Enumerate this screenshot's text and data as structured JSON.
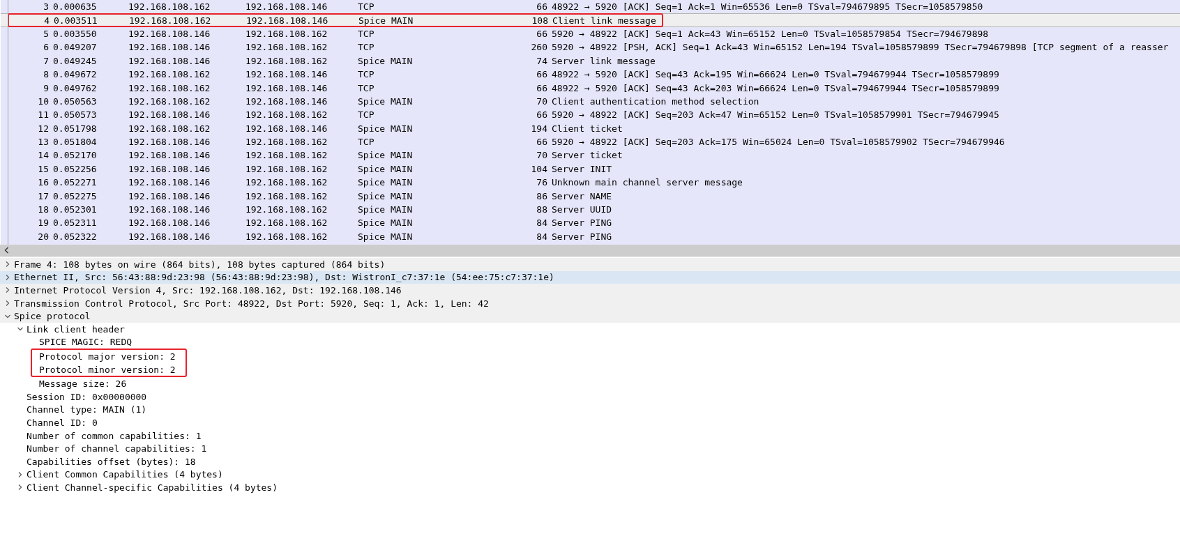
{
  "packet_list": {
    "rows": [
      {
        "no": "3",
        "time": "0.000635",
        "source": "192.168.108.162",
        "destination": "192.168.108.146",
        "protocol": "TCP",
        "length": "66",
        "info": "48922 → 5920 [ACK] Seq=1 Ack=1 Win=65536 Len=0 TSval=794679895 TSecr=1058579850",
        "selected": false,
        "annotated": false
      },
      {
        "no": "4",
        "time": "0.003511",
        "source": "192.168.108.162",
        "destination": "192.168.108.146",
        "protocol": "Spice MAIN",
        "length": "108",
        "info": "Client link message",
        "selected": true,
        "annotated": true
      },
      {
        "no": "5",
        "time": "0.003550",
        "source": "192.168.108.146",
        "destination": "192.168.108.162",
        "protocol": "TCP",
        "length": "66",
        "info": "5920 → 48922 [ACK] Seq=1 Ack=43 Win=65152 Len=0 TSval=1058579854 TSecr=794679898",
        "selected": false,
        "annotated": false
      },
      {
        "no": "6",
        "time": "0.049207",
        "source": "192.168.108.146",
        "destination": "192.168.108.162",
        "protocol": "TCP",
        "length": "260",
        "info": "5920 → 48922 [PSH, ACK] Seq=1 Ack=43 Win=65152 Len=194 TSval=1058579899 TSecr=794679898 [TCP segment of a reasser",
        "selected": false,
        "annotated": false
      },
      {
        "no": "7",
        "time": "0.049245",
        "source": "192.168.108.146",
        "destination": "192.168.108.162",
        "protocol": "Spice MAIN",
        "length": "74",
        "info": "Server link message",
        "selected": false,
        "annotated": false
      },
      {
        "no": "8",
        "time": "0.049672",
        "source": "192.168.108.162",
        "destination": "192.168.108.146",
        "protocol": "TCP",
        "length": "66",
        "info": "48922 → 5920 [ACK] Seq=43 Ack=195 Win=66624 Len=0 TSval=794679944 TSecr=1058579899",
        "selected": false,
        "annotated": false
      },
      {
        "no": "9",
        "time": "0.049762",
        "source": "192.168.108.162",
        "destination": "192.168.108.146",
        "protocol": "TCP",
        "length": "66",
        "info": "48922 → 5920 [ACK] Seq=43 Ack=203 Win=66624 Len=0 TSval=794679944 TSecr=1058579899",
        "selected": false,
        "annotated": false
      },
      {
        "no": "10",
        "time": "0.050563",
        "source": "192.168.108.162",
        "destination": "192.168.108.146",
        "protocol": "Spice MAIN",
        "length": "70",
        "info": "Client authentication method selection",
        "selected": false,
        "annotated": false
      },
      {
        "no": "11",
        "time": "0.050573",
        "source": "192.168.108.146",
        "destination": "192.168.108.162",
        "protocol": "TCP",
        "length": "66",
        "info": "5920 → 48922 [ACK] Seq=203 Ack=47 Win=65152 Len=0 TSval=1058579901 TSecr=794679945",
        "selected": false,
        "annotated": false
      },
      {
        "no": "12",
        "time": "0.051798",
        "source": "192.168.108.162",
        "destination": "192.168.108.146",
        "protocol": "Spice MAIN",
        "length": "194",
        "info": "Client ticket",
        "selected": false,
        "annotated": false
      },
      {
        "no": "13",
        "time": "0.051804",
        "source": "192.168.108.146",
        "destination": "192.168.108.162",
        "protocol": "TCP",
        "length": "66",
        "info": "5920 → 48922 [ACK] Seq=203 Ack=175 Win=65024 Len=0 TSval=1058579902 TSecr=794679946",
        "selected": false,
        "annotated": false
      },
      {
        "no": "14",
        "time": "0.052170",
        "source": "192.168.108.146",
        "destination": "192.168.108.162",
        "protocol": "Spice MAIN",
        "length": "70",
        "info": "Server ticket",
        "selected": false,
        "annotated": false
      },
      {
        "no": "15",
        "time": "0.052256",
        "source": "192.168.108.146",
        "destination": "192.168.108.162",
        "protocol": "Spice MAIN",
        "length": "104",
        "info": "Server INIT",
        "selected": false,
        "annotated": false
      },
      {
        "no": "16",
        "time": "0.052271",
        "source": "192.168.108.146",
        "destination": "192.168.108.162",
        "protocol": "Spice MAIN",
        "length": "76",
        "info": "Unknown main channel server message",
        "selected": false,
        "annotated": false
      },
      {
        "no": "17",
        "time": "0.052275",
        "source": "192.168.108.146",
        "destination": "192.168.108.162",
        "protocol": "Spice MAIN",
        "length": "86",
        "info": "Server NAME",
        "selected": false,
        "annotated": false
      },
      {
        "no": "18",
        "time": "0.052301",
        "source": "192.168.108.146",
        "destination": "192.168.108.162",
        "protocol": "Spice MAIN",
        "length": "88",
        "info": "Server UUID",
        "selected": false,
        "annotated": false
      },
      {
        "no": "19",
        "time": "0.052311",
        "source": "192.168.108.146",
        "destination": "192.168.108.162",
        "protocol": "Spice MAIN",
        "length": "84",
        "info": "Server PING",
        "selected": false,
        "annotated": false
      },
      {
        "no": "20",
        "time": "0.052322",
        "source": "192.168.108.146",
        "destination": "192.168.108.162",
        "protocol": "Spice MAIN",
        "length": "84",
        "info": "Server PING",
        "selected": false,
        "annotated": false
      }
    ]
  },
  "packet_details": [
    {
      "kind": "subtree",
      "text": "Frame 4: 108 bytes on wire (864 bits), 108 bytes captured (864 bits)",
      "expanded": false,
      "selected": false
    },
    {
      "kind": "subtree",
      "text": "Ethernet II, Src: 56:43:88:9d:23:98 (56:43:88:9d:23:98), Dst: WistronI_c7:37:1e (54:ee:75:c7:37:1e)",
      "expanded": false,
      "selected": true
    },
    {
      "kind": "subtree",
      "text": "Internet Protocol Version 4, Src: 192.168.108.162, Dst: 192.168.108.146",
      "expanded": false,
      "selected": false
    },
    {
      "kind": "subtree",
      "text": "Transmission Control Protocol, Src Port: 48922, Dst Port: 5920, Seq: 1, Ack: 1, Len: 42",
      "expanded": false,
      "selected": false
    },
    {
      "kind": "subtree",
      "text": "Spice protocol",
      "expanded": true,
      "selected": false,
      "children": [
        {
          "kind": "subtree",
          "text": "Link client header",
          "expanded": true,
          "selected": false,
          "children": [
            {
              "kind": "field",
              "text": "SPICE MAGIC: REDQ",
              "annotated": false
            },
            {
              "kind": "field",
              "text": "Protocol major version: 2",
              "annotated": true
            },
            {
              "kind": "field",
              "text": "Protocol minor version: 2",
              "annotated": true
            },
            {
              "kind": "field",
              "text": "Message size: 26",
              "annotated": false
            }
          ]
        },
        {
          "kind": "field",
          "text": "Session ID: 0x00000000",
          "annotated": false
        },
        {
          "kind": "field",
          "text": "Channel type: MAIN (1)",
          "annotated": false
        },
        {
          "kind": "field",
          "text": "Channel ID: 0",
          "annotated": false
        },
        {
          "kind": "field",
          "text": "Number of common capabilities: 1",
          "annotated": false
        },
        {
          "kind": "field",
          "text": "Number of channel capabilities: 1",
          "annotated": false
        },
        {
          "kind": "field",
          "text": "Capabilities offset (bytes): 18",
          "annotated": false
        },
        {
          "kind": "subtree",
          "text": "Client Common Capabilities (4 bytes)",
          "expanded": false,
          "selected": false
        },
        {
          "kind": "subtree",
          "text": "Client Channel-specific Capabilities (4 bytes)",
          "expanded": false,
          "selected": false
        }
      ]
    }
  ]
}
